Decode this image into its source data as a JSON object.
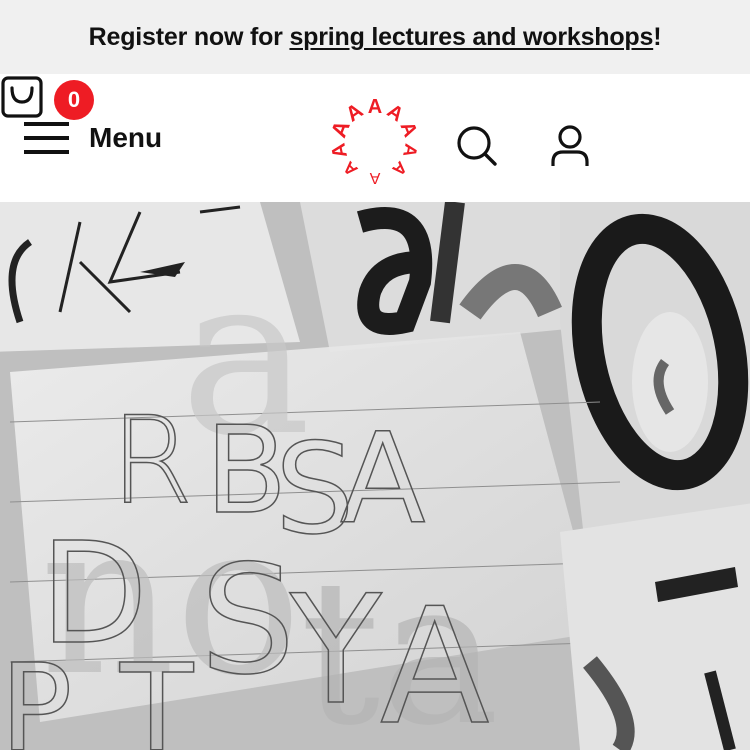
{
  "banner": {
    "prefix": "Register now for ",
    "link_text": "spring lectures and workshops",
    "suffix": "!"
  },
  "header": {
    "menu_label": "Menu",
    "cart_count": "0",
    "icons": {
      "menu": "hamburger-icon",
      "search": "search-icon",
      "account": "user-icon",
      "cart": "shopping-bag-icon"
    }
  },
  "logo": {
    "letters": "AAAAAAAAAA"
  },
  "hero": {
    "description_letters": [
      "R",
      "B",
      "S",
      "A",
      "D",
      "S",
      "Y",
      "A",
      "a",
      "b",
      "O"
    ]
  },
  "colors": {
    "accent": "#ee1c24",
    "banner_bg": "#f0f0f0",
    "text": "#111111"
  }
}
